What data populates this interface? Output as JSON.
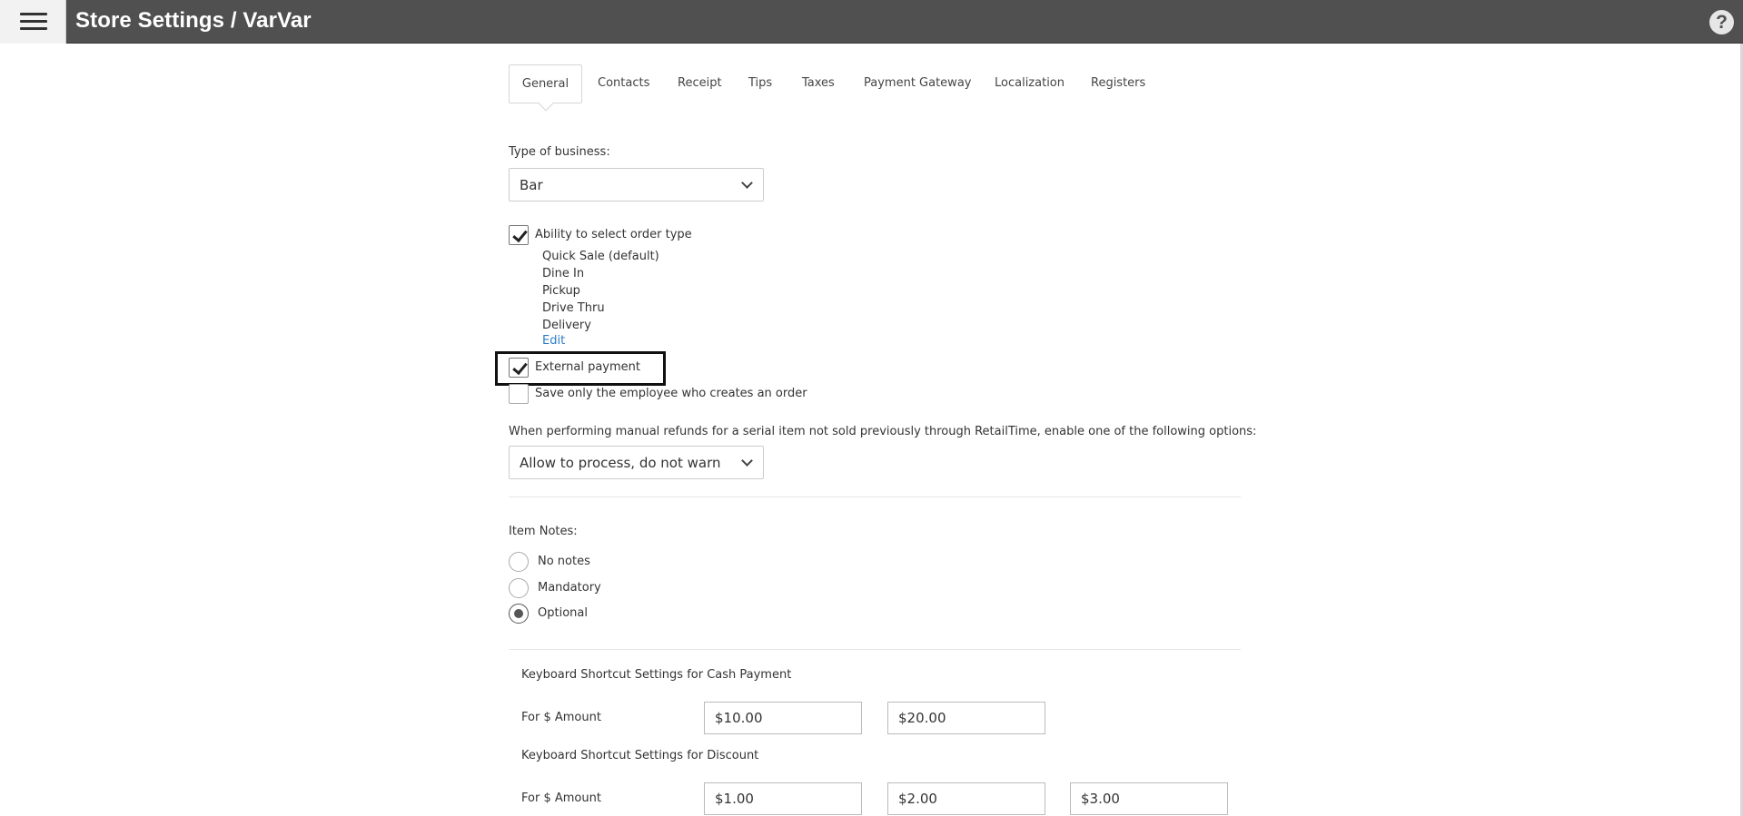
{
  "header": {
    "title": "Store Settings / VarVar",
    "menu_icon": "hamburger-menu-icon",
    "help_icon": "help-icon",
    "help_glyph": "?",
    "bar_color": "#505050"
  },
  "tabs": [
    {
      "label": "General",
      "active": true
    },
    {
      "label": "Contacts"
    },
    {
      "label": "Receipt"
    },
    {
      "label": "Tips"
    },
    {
      "label": "Taxes"
    },
    {
      "label": "Payment Gateway"
    },
    {
      "label": "Localization"
    },
    {
      "label": "Registers"
    }
  ],
  "business": {
    "label": "Type of business:",
    "value": "Bar"
  },
  "order_type": {
    "label": "Ability to select order type",
    "checked": true,
    "items": [
      "Quick Sale (default)",
      "Dine In",
      "Pickup",
      "Drive Thru",
      "Delivery"
    ],
    "edit_label": "Edit",
    "link_color": "#2a7cc7"
  },
  "external_payment": {
    "label": "External payment",
    "checked": true
  },
  "save_employee": {
    "label": "Save only the employee who creates an order",
    "checked": false
  },
  "refunds": {
    "label": "When performing manual refunds for a serial item not sold previously through RetailTime, enable one of the following options:",
    "value": "Allow to process, do not warn"
  },
  "item_notes": {
    "label": "Item Notes:",
    "options": [
      {
        "label": "No notes",
        "selected": false
      },
      {
        "label": "Mandatory",
        "selected": false
      },
      {
        "label": "Optional",
        "selected": true
      }
    ]
  },
  "cash_shortcuts": {
    "title": "Keyboard Shortcut Settings for Cash Payment",
    "row_label": "For $ Amount",
    "values": [
      "$10.00",
      "$20.00"
    ]
  },
  "discount_shortcuts": {
    "title": "Keyboard Shortcut Settings for Discount",
    "row_label": "For $ Amount",
    "values": [
      "$1.00",
      "$2.00",
      "$3.00"
    ]
  }
}
